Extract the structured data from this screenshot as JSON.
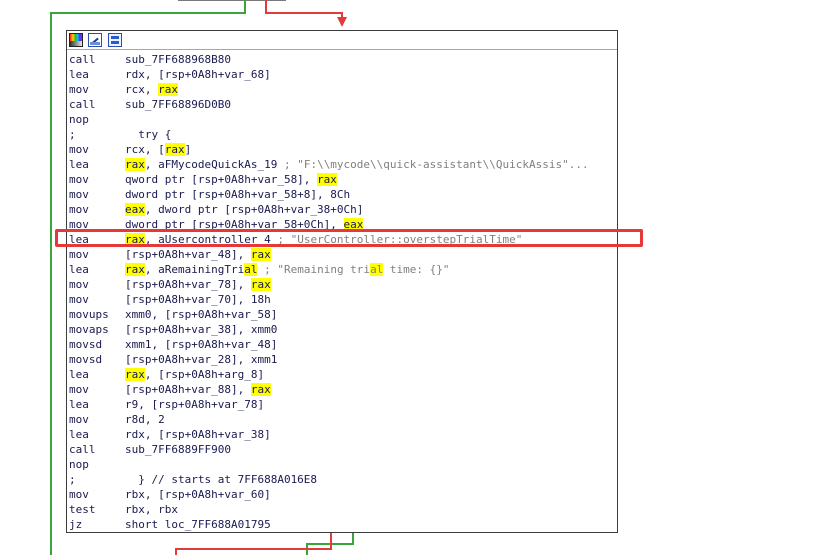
{
  "colors": {
    "edge_green": "#3aa53a",
    "edge_red": "#e23b3b",
    "highlight": "#ffff00",
    "callout_box": "#e73838"
  },
  "toolbar_icons": [
    "palette-icon",
    "rename-icon",
    "graph-icon"
  ],
  "lines": [
    {
      "mn": "call",
      "parts": [
        {
          "t": "sub_7FF688968B80"
        }
      ]
    },
    {
      "mn": "lea",
      "parts": [
        {
          "t": "rdx, [rsp+0A8h+var_68]"
        }
      ]
    },
    {
      "mn": "mov",
      "parts": [
        {
          "t": "rcx, "
        },
        {
          "t": "rax",
          "hl": true
        }
      ]
    },
    {
      "mn": "call",
      "parts": [
        {
          "t": "sub_7FF68896D0B0"
        }
      ]
    },
    {
      "mn": "nop",
      "parts": []
    },
    {
      "mn": ";",
      "parts": [
        {
          "t": "  try {",
          "c": "ct"
        }
      ]
    },
    {
      "mn": "mov",
      "parts": [
        {
          "t": "rcx, ["
        },
        {
          "t": "rax",
          "hl": true
        },
        {
          "t": "]"
        }
      ]
    },
    {
      "mn": "lea",
      "parts": [
        {
          "t": "rax",
          "hl": true
        },
        {
          "t": ", aFMycodeQuickAs_19 "
        },
        {
          "t": "; \"F:\\\\mycode\\\\quick-assistant\\\\QuickAssis\"...",
          "c": "cm"
        }
      ]
    },
    {
      "mn": "mov",
      "parts": [
        {
          "t": "qword ptr [rsp+0A8h+var_58], "
        },
        {
          "t": "rax",
          "hl": true
        }
      ]
    },
    {
      "mn": "mov",
      "parts": [
        {
          "t": "dword ptr [rsp+0A8h+var_58+8], 8Ch"
        }
      ]
    },
    {
      "mn": "mov",
      "parts": [
        {
          "t": "eax",
          "hl": true
        },
        {
          "t": ", dword ptr [rsp+0A8h+var_38+0Ch]"
        }
      ]
    },
    {
      "mn": "mov",
      "parts": [
        {
          "t": "dword ptr [rsp+0A8h+var_58+0Ch], "
        },
        {
          "t": "eax",
          "hl": true
        }
      ]
    },
    {
      "mn": "lea",
      "parts": [
        {
          "t": "rax",
          "hl": true
        },
        {
          "t": ", aUsercontroller_4 "
        },
        {
          "t": "; \"UserController::overstepTrialTime\"",
          "c": "cm"
        }
      ]
    },
    {
      "mn": "mov",
      "parts": [
        {
          "t": "[rsp+0A8h+var_48], "
        },
        {
          "t": "rax",
          "hl": true
        }
      ]
    },
    {
      "mn": "lea",
      "parts": [
        {
          "t": "rax",
          "hl": true
        },
        {
          "t": ", aRemainingTri"
        },
        {
          "t": "al",
          "hl": true
        },
        {
          "t": " "
        },
        {
          "t": "; \"Remaining tri",
          "c": "cm"
        },
        {
          "t": "al",
          "hl": true,
          "c": "cm"
        },
        {
          "t": " time: {}\"",
          "c": "cm"
        }
      ]
    },
    {
      "mn": "mov",
      "parts": [
        {
          "t": "[rsp+0A8h+var_78], "
        },
        {
          "t": "rax",
          "hl": true
        }
      ]
    },
    {
      "mn": "mov",
      "parts": [
        {
          "t": "[rsp+0A8h+var_70], 18h"
        }
      ]
    },
    {
      "mn": "movups",
      "parts": [
        {
          "t": "xmm0, [rsp+0A8h+var_58]"
        }
      ]
    },
    {
      "mn": "movaps",
      "parts": [
        {
          "t": "[rsp+0A8h+var_38], xmm0"
        }
      ]
    },
    {
      "mn": "movsd",
      "parts": [
        {
          "t": "xmm1, [rsp+0A8h+var_48]"
        }
      ]
    },
    {
      "mn": "movsd",
      "parts": [
        {
          "t": "[rsp+0A8h+var_28], xmm1"
        }
      ]
    },
    {
      "mn": "lea",
      "parts": [
        {
          "t": "rax",
          "hl": true
        },
        {
          "t": ", [rsp+0A8h+arg_8]"
        }
      ]
    },
    {
      "mn": "mov",
      "parts": [
        {
          "t": "[rsp+0A8h+var_88], "
        },
        {
          "t": "rax",
          "hl": true
        }
      ]
    },
    {
      "mn": "lea",
      "parts": [
        {
          "t": "r9, [rsp+0A8h+var_78]"
        }
      ]
    },
    {
      "mn": "mov",
      "parts": [
        {
          "t": "r8d, 2"
        }
      ]
    },
    {
      "mn": "lea",
      "parts": [
        {
          "t": "rdx, [rsp+0A8h+var_38]"
        }
      ]
    },
    {
      "mn": "call",
      "parts": [
        {
          "t": "sub_7FF6889FF900"
        }
      ]
    },
    {
      "mn": "nop",
      "parts": []
    },
    {
      "mn": ";",
      "parts": [
        {
          "t": "  } // starts at 7FF688A016E8",
          "c": "ct"
        }
      ]
    },
    {
      "mn": "mov",
      "parts": [
        {
          "t": "rbx, [rsp+0A8h+var_60]"
        }
      ]
    },
    {
      "mn": "test",
      "parts": [
        {
          "t": "rbx, rbx"
        }
      ]
    },
    {
      "mn": "jz",
      "parts": [
        {
          "t": "short loc_7FF688A01795"
        }
      ]
    }
  ]
}
